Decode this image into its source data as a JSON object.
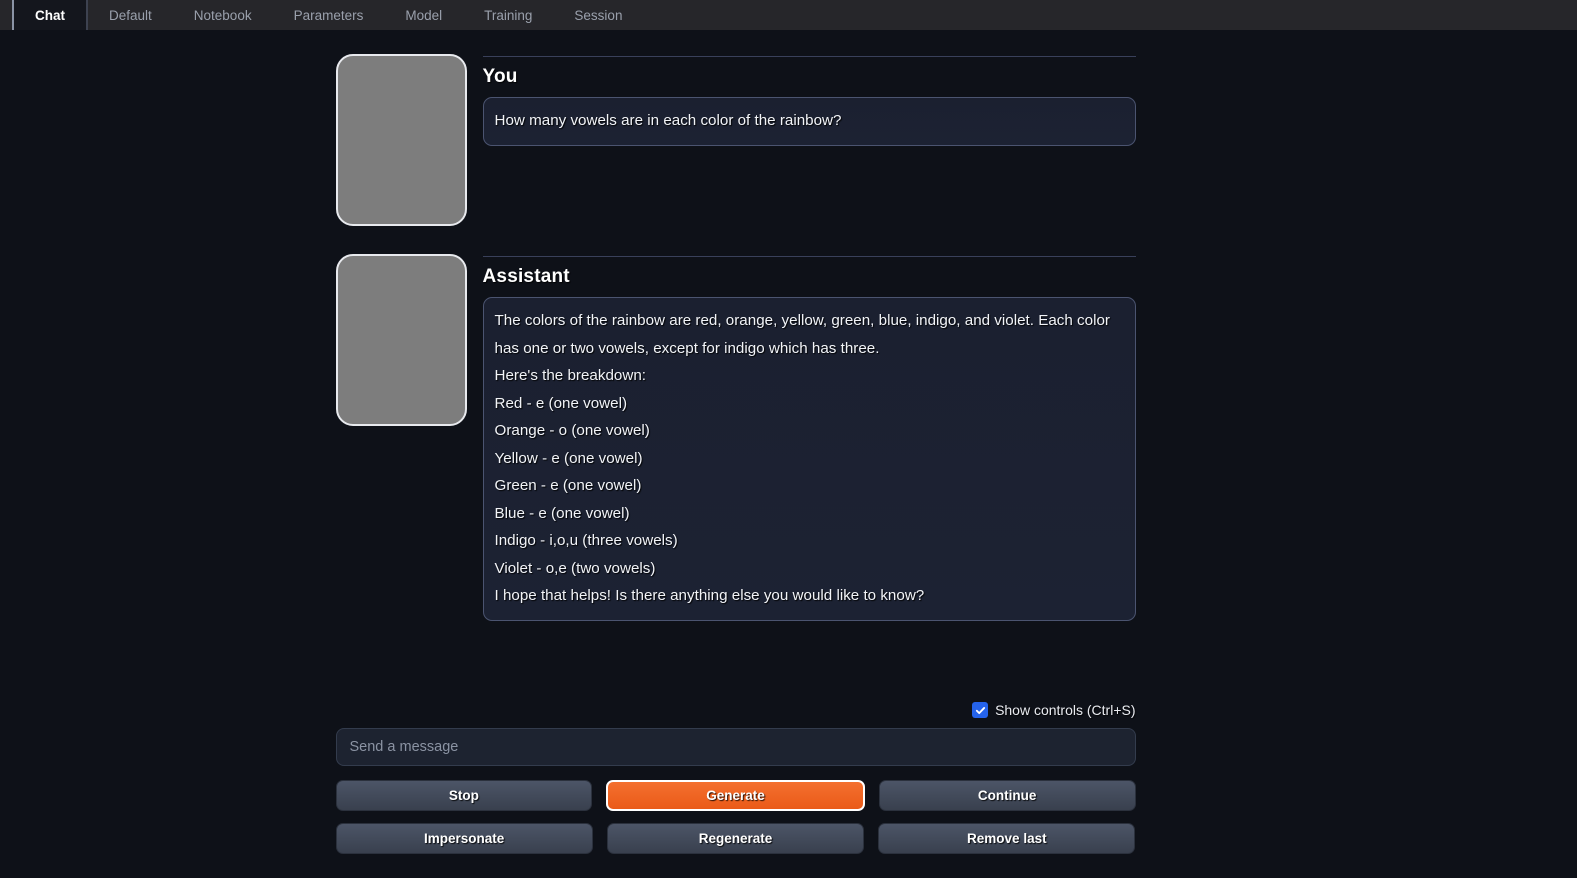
{
  "tabs": [
    {
      "label": "Chat",
      "active": true
    },
    {
      "label": "Default",
      "active": false
    },
    {
      "label": "Notebook",
      "active": false
    },
    {
      "label": "Parameters",
      "active": false
    },
    {
      "label": "Model",
      "active": false
    },
    {
      "label": "Training",
      "active": false
    },
    {
      "label": "Session",
      "active": false
    }
  ],
  "conversation": [
    {
      "author": "You",
      "lines": [
        "How many vowels are in each color of the rainbow?"
      ]
    },
    {
      "author": "Assistant",
      "lines": [
        "The colors of the rainbow are red, orange, yellow, green, blue, indigo, and violet. Each color has one or two vowels, except for indigo which has three.",
        "Here's the breakdown:",
        "Red - e (one vowel)",
        "Orange - o (one vowel)",
        "Yellow - e (one vowel)",
        "Green - e (one vowel)",
        "Blue - e (one vowel)",
        "Indigo - i,o,u (three vowels)",
        "Violet - o,e (two vowels)",
        "I hope that helps! Is there anything else you would like to know?"
      ]
    }
  ],
  "controls": {
    "show_controls_label": "Show controls (Ctrl+S)",
    "show_controls_checked": true,
    "input_value": "",
    "input_placeholder": "Send a message",
    "buttons_row1": [
      {
        "label": "Stop",
        "primary": false
      },
      {
        "label": "Generate",
        "primary": true
      },
      {
        "label": "Continue",
        "primary": false
      }
    ],
    "buttons_row2": [
      {
        "label": "Impersonate",
        "primary": false
      },
      {
        "label": "Regenerate",
        "primary": false
      },
      {
        "label": "Remove last",
        "primary": false
      }
    ]
  },
  "colors": {
    "background": "#0e1118",
    "topbar": "#26262a",
    "accent": "#ea5a18",
    "checkbox": "#2563eb",
    "avatar": "#7d7d7d"
  }
}
